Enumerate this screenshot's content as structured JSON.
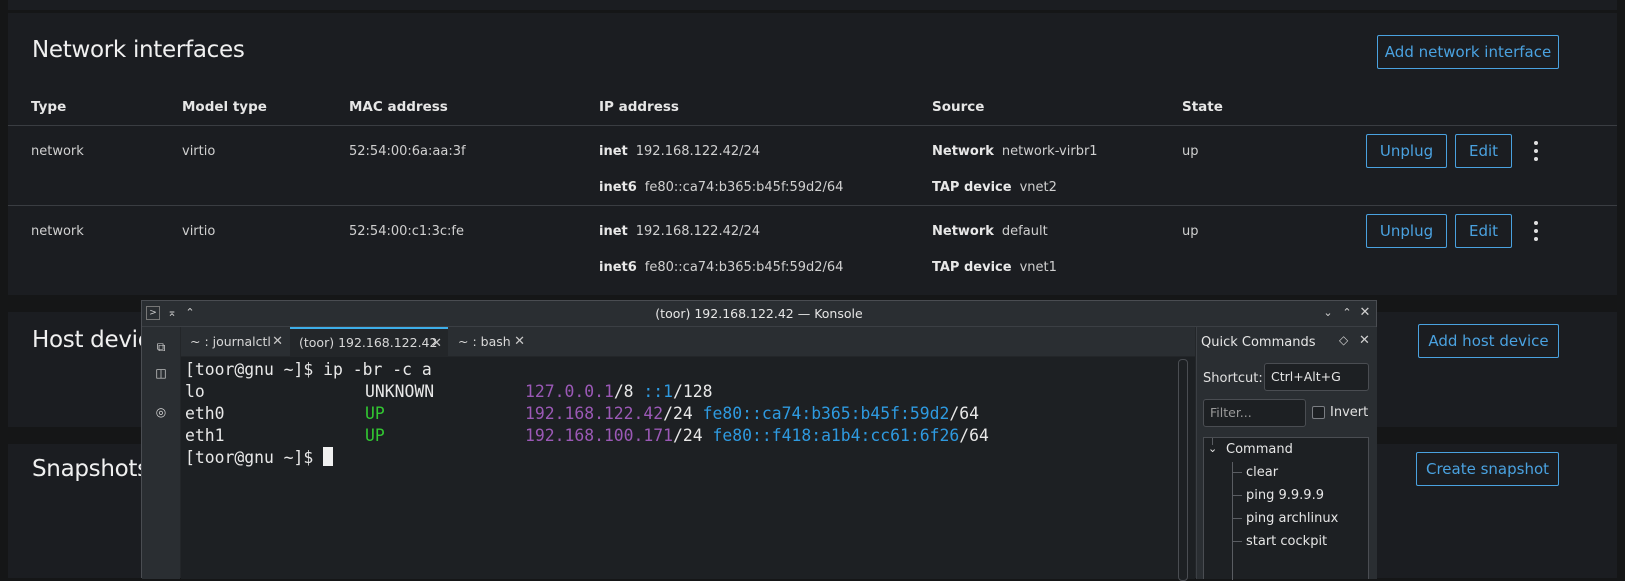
{
  "network": {
    "title": "Network interfaces",
    "add_button": "Add network interface",
    "columns": [
      "Type",
      "Model type",
      "MAC address",
      "IP address",
      "Source",
      "State"
    ],
    "rows": [
      {
        "type": "network",
        "model": "virtio",
        "mac": "52:54:00:6a:aa:3f",
        "inet_label": "inet",
        "inet": "192.168.122.42/24",
        "inet6_label": "inet6",
        "inet6": "fe80::ca74:b365:b45f:59d2/64",
        "source_label": "Network",
        "source": "network-virbr1",
        "tap_label": "TAP device",
        "tap": "vnet2",
        "state": "up",
        "unplug": "Unplug",
        "edit": "Edit"
      },
      {
        "type": "network",
        "model": "virtio",
        "mac": "52:54:00:c1:3c:fe",
        "inet_label": "inet",
        "inet": "192.168.122.42/24",
        "inet6_label": "inet6",
        "inet6": "fe80::ca74:b365:b45f:59d2/64",
        "source_label": "Network",
        "source": "default",
        "tap_label": "TAP device",
        "tap": "vnet1",
        "state": "up",
        "unplug": "Unplug",
        "edit": "Edit"
      }
    ]
  },
  "host_devices": {
    "title": "Host devic",
    "add_button": "Add host device"
  },
  "snapshots": {
    "title": "Snapshots",
    "add_button": "Create snapshot"
  },
  "konsole": {
    "title": "(toor) 192.168.122.42 — Konsole",
    "tabs": [
      {
        "label": "~ : journalctl"
      },
      {
        "label": "(toor) 192.168.122.42"
      },
      {
        "label": "~ : bash"
      }
    ],
    "terminal": {
      "prompt": "[toor@gnu ~]$ ",
      "command": "ip -br -c a",
      "lines": [
        {
          "iface": "lo",
          "state": "UNKNOWN",
          "ip4": "127.0.0.1",
          "ip4_suffix": "/8 ",
          "ip6": "::1",
          "ip6_suffix": "/128"
        },
        {
          "iface": "eth0",
          "state": "UP",
          "ip4": "192.168.122.42",
          "ip4_suffix": "/24 ",
          "ip6": "fe80::ca74:b365:b45f:59d2",
          "ip6_suffix": "/64"
        },
        {
          "iface": "eth1",
          "state": "UP",
          "ip4": "192.168.100.171",
          "ip4_suffix": "/24 ",
          "ip6": "fe80::f418:a1b4:cc61:6f26",
          "ip6_suffix": "/64"
        }
      ]
    },
    "quick_commands": {
      "title": "Quick Commands",
      "shortcut_label": "Shortcut:",
      "shortcut_value": "Ctrl+Alt+G",
      "filter_placeholder": "Filter...",
      "invert_label": "Invert",
      "group": "Command",
      "items": [
        "clear",
        "ping 9.9.9.9",
        "ping archlinux",
        "start cockpit"
      ]
    }
  },
  "colors": {
    "accent": "#4aa2e0",
    "terminal_purple": "#9b59b6",
    "terminal_blue": "#2e9ae0",
    "terminal_green": "#32c832"
  }
}
